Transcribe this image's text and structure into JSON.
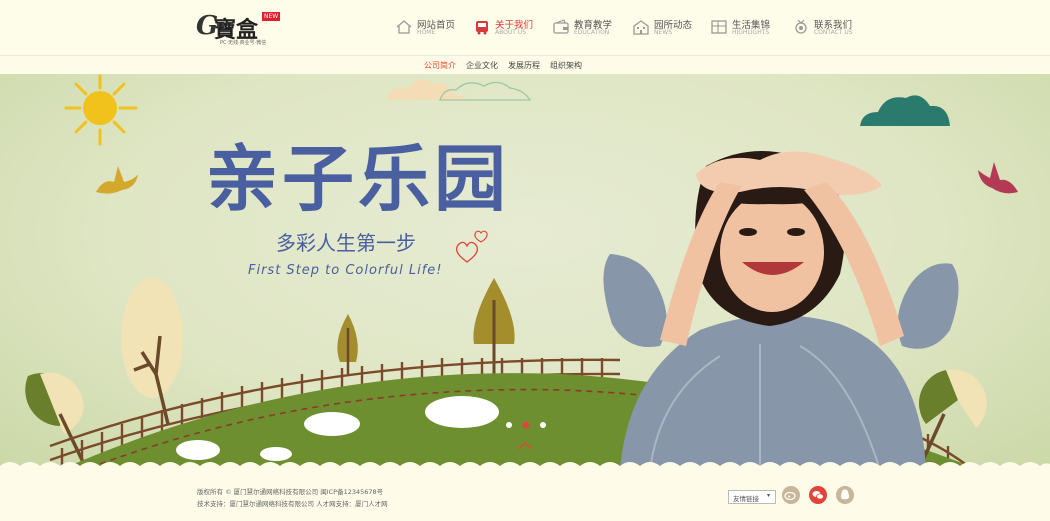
{
  "logo": {
    "mark": "G",
    "name": "寶盒",
    "badge": "NEW",
    "tagline": "PC·无线·商业号·微信"
  },
  "nav": [
    {
      "zh": "网站首页",
      "en": "HOME",
      "icon": "home-icon"
    },
    {
      "zh": "关于我们",
      "en": "ABOUT US",
      "icon": "bus-icon"
    },
    {
      "zh": "教育教学",
      "en": "EDUCATION",
      "icon": "wallet-icon"
    },
    {
      "zh": "园所动态",
      "en": "NEWS",
      "icon": "building-icon"
    },
    {
      "zh": "生活集锦",
      "en": "HIGHLIGHTS",
      "icon": "grid-icon"
    },
    {
      "zh": "联系我们",
      "en": "CONTACT US",
      "icon": "medal-icon"
    }
  ],
  "subnav": [
    "公司简介",
    "企业文化",
    "发展历程",
    "组织架构"
  ],
  "banner": {
    "title": "亲子乐园",
    "subtitle": "多彩人生第一步",
    "english": "First Step to Colorful Life!"
  },
  "footer": {
    "copyright": "版权所有 © 厦门慧尔通网络科技有限公司   闽ICP备12345678号",
    "support": "技术支持：厦门慧尔通网络科技有限公司   人才网支持：厦门人才网",
    "links_label": "友情链接",
    "links_arrow": "▾"
  },
  "colors": {
    "accent": "#d83a3a",
    "title_blue": "#4a5fa0",
    "grass": "#6e8f30"
  }
}
